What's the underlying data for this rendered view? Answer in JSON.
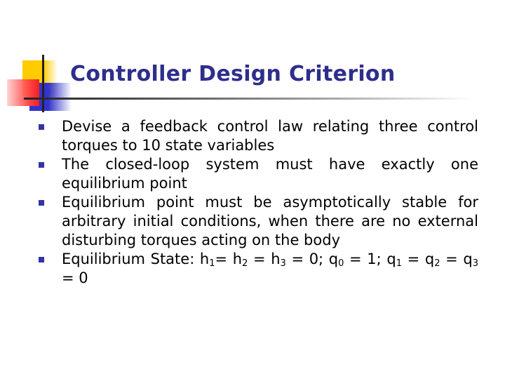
{
  "slide": {
    "title": "Controller Design Criterion",
    "accent_color": "#2e2e8c",
    "bullet_icon": "square-bullet",
    "bullets": [
      {
        "text": "Devise a feedback control law relating three control torques to 10 state variables"
      },
      {
        "text": "The closed-loop system must have exactly one equilibrium point"
      },
      {
        "text": "Equilibrium point must be asymptotically stable for arbitrary initial conditions, when there are no external disturbing torques acting on the body"
      },
      {
        "prefix": "Equilibrium State: ",
        "h": "h",
        "s1": "1",
        "eq1": "= ",
        "s2": "2",
        "eq2": " = ",
        "s3": "3",
        "eq3": " = 0; ",
        "q": "q",
        "q0": "0",
        "qeq0": " = 1; ",
        "q1": "1",
        "qeq1": " = ",
        "q2": "2",
        "qeq2": " = ",
        "q3": "3",
        "qeq3": " = 0"
      }
    ]
  }
}
